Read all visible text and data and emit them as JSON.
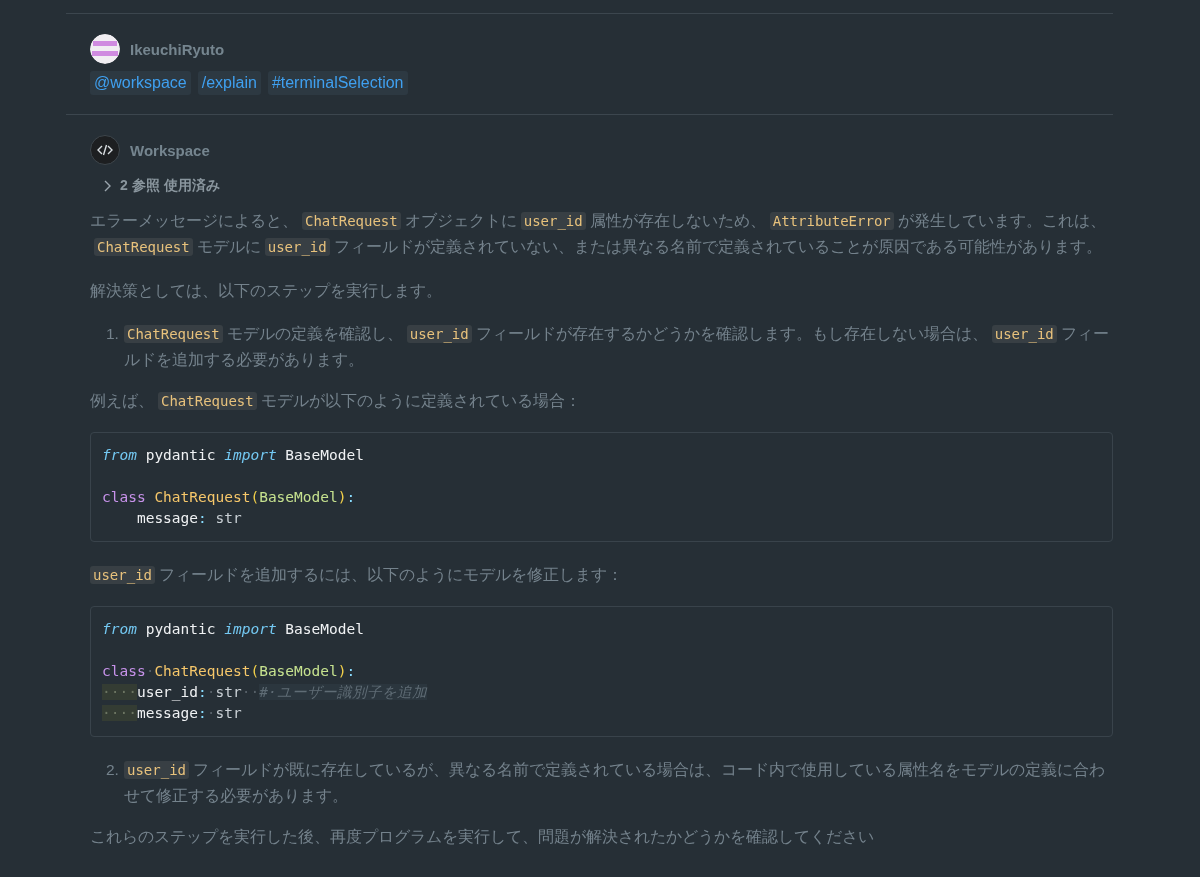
{
  "user_message": {
    "author": "IkeuchiRyuto",
    "tags": [
      "@workspace",
      "/explain",
      "#terminalSelection"
    ]
  },
  "response": {
    "author": "Workspace",
    "references": {
      "label": "2 参照 使用済み",
      "expanded": false
    },
    "blocks": [
      {
        "kind": "paragraph",
        "segments": [
          {
            "kind": "text",
            "text": "エラーメッセージによると、"
          },
          {
            "kind": "code",
            "text": "ChatRequest"
          },
          {
            "kind": "text",
            "text": "オブジェクトに"
          },
          {
            "kind": "code",
            "text": "user_id"
          },
          {
            "kind": "text",
            "text": "属性が存在しないため、"
          },
          {
            "kind": "code",
            "text": "AttributeError"
          },
          {
            "kind": "text",
            "text": "が発生しています。これは、"
          },
          {
            "kind": "code",
            "text": "ChatRequest"
          },
          {
            "kind": "text",
            "text": "モデルに"
          },
          {
            "kind": "code",
            "text": "user_id"
          },
          {
            "kind": "text",
            "text": "フィールドが定義されていない、または異なる名前で定義されていることが原因である可能性があります。"
          }
        ]
      },
      {
        "kind": "paragraph",
        "segments": [
          {
            "kind": "text",
            "text": "解決策としては、以下のステップを実行します。"
          }
        ]
      },
      {
        "kind": "list_item",
        "number": "1.",
        "segments": [
          {
            "kind": "code",
            "text": "ChatRequest"
          },
          {
            "kind": "text",
            "text": "モデルの定義を確認し、"
          },
          {
            "kind": "code",
            "text": "user_id"
          },
          {
            "kind": "text",
            "text": "フィールドが存在するかどうかを確認します。もし存在しない場合は、"
          },
          {
            "kind": "code",
            "text": "user_id"
          },
          {
            "kind": "text",
            "text": "フィールドを追加する必要があります。"
          }
        ]
      },
      {
        "kind": "paragraph",
        "segments": [
          {
            "kind": "text",
            "text": "例えば、"
          },
          {
            "kind": "code",
            "text": "ChatRequest"
          },
          {
            "kind": "text",
            "text": "モデルが以下のように定義されている場合："
          }
        ]
      },
      {
        "kind": "code_block",
        "lines": [
          {
            "kind": "code",
            "tokens": [
              {
                "kind": "keyword",
                "text": "from"
              },
              {
                "kind": "plain",
                "text": " pydantic "
              },
              {
                "kind": "keyword",
                "text": "import"
              },
              {
                "kind": "plain",
                "text": " BaseModel"
              }
            ]
          },
          {
            "kind": "blank"
          },
          {
            "kind": "code",
            "tokens": [
              {
                "kind": "storage",
                "text": "class "
              },
              {
                "kind": "class",
                "text": "ChatRequest"
              },
              {
                "kind": "paren",
                "text": "("
              },
              {
                "kind": "base",
                "text": "BaseModel"
              },
              {
                "kind": "paren",
                "text": ")"
              },
              {
                "kind": "punct",
                "text": ":"
              }
            ]
          },
          {
            "kind": "code",
            "tokens": [
              {
                "kind": "plain",
                "text": "    message"
              },
              {
                "kind": "punct",
                "text": ":"
              },
              {
                "kind": "type",
                "text": " str"
              }
            ]
          }
        ]
      },
      {
        "kind": "paragraph",
        "segments": [
          {
            "kind": "code",
            "text": "user_id"
          },
          {
            "kind": "text",
            "text": "フィールドを追加するには、以下のようにモデルを修正します："
          }
        ]
      },
      {
        "kind": "code_block",
        "lines": [
          {
            "kind": "code",
            "tokens": [
              {
                "kind": "keyword",
                "text": "from"
              },
              {
                "kind": "plain",
                "text": " pydantic "
              },
              {
                "kind": "keyword",
                "text": "import"
              },
              {
                "kind": "plain",
                "text": " BaseModel"
              }
            ]
          },
          {
            "kind": "blank"
          },
          {
            "kind": "code",
            "tokens": [
              {
                "kind": "storage",
                "text": "class"
              },
              {
                "kind": "ws",
                "text": "·"
              },
              {
                "kind": "class",
                "text": "ChatRequest"
              },
              {
                "kind": "paren",
                "text": "("
              },
              {
                "kind": "base",
                "text": "BaseModel"
              },
              {
                "kind": "paren",
                "text": ")"
              },
              {
                "kind": "punct",
                "text": ":"
              }
            ]
          },
          {
            "kind": "code",
            "tokens": [
              {
                "kind": "indent",
                "text": "····"
              },
              {
                "kind": "plain",
                "text": "user_id"
              },
              {
                "kind": "punct",
                "text": ":"
              },
              {
                "kind": "ws",
                "text": "·"
              },
              {
                "kind": "type",
                "text": "str"
              },
              {
                "kind": "ws",
                "text": "··"
              },
              {
                "kind": "comment",
                "text": "#·ユーザー識別子を追加"
              }
            ]
          },
          {
            "kind": "code",
            "tokens": [
              {
                "kind": "indent",
                "text": "····"
              },
              {
                "kind": "plain",
                "text": "message"
              },
              {
                "kind": "punct",
                "text": ":"
              },
              {
                "kind": "ws",
                "text": "·"
              },
              {
                "kind": "type",
                "text": "str"
              }
            ]
          }
        ]
      },
      {
        "kind": "list_item",
        "number": "2.",
        "segments": [
          {
            "kind": "code",
            "text": "user_id"
          },
          {
            "kind": "text",
            "text": "フィールドが既に存在しているが、異なる名前で定義されている場合は、コード内で使用している属性名をモデルの定義に合わせて修正する必要があります。"
          }
        ]
      },
      {
        "kind": "paragraph",
        "segments": [
          {
            "kind": "text",
            "text": "これらのステップを実行した後、再度プログラムを実行して、問題が解決されたかどうかを確認してください"
          }
        ]
      }
    ]
  }
}
